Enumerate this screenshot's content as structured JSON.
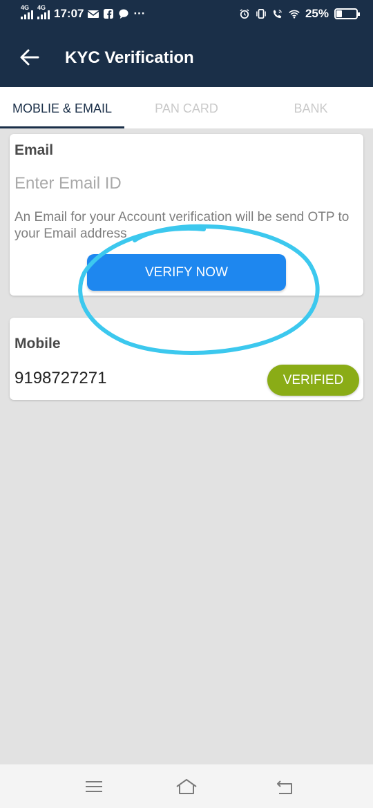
{
  "status_bar": {
    "network_1": "4G",
    "network_2": "4G",
    "time": "17:07",
    "battery_percent": "25%",
    "battery_level": 0.25,
    "icons": [
      "signal-icon",
      "mail-icon",
      "facebook-icon",
      "chat-icon",
      "more-icon",
      "alarm-icon",
      "vibrate-icon",
      "wifi-call-icon",
      "wifi-icon",
      "battery-icon"
    ]
  },
  "app_bar": {
    "title": "KYC Verification",
    "back_icon": "arrow-left-icon"
  },
  "tabs": [
    {
      "label": "MOBLIE & EMAIL",
      "active": true
    },
    {
      "label": "PAN CARD",
      "active": false
    },
    {
      "label": "BANK",
      "active": false
    }
  ],
  "email_card": {
    "title": "Email",
    "input_value": "",
    "input_placeholder": "Enter Email ID",
    "note": "An Email for your Account verification will be send OTP to your Email address",
    "verify_label": "VERIFY NOW"
  },
  "mobile_card": {
    "title": "Mobile",
    "number": "9198727271",
    "status_label": "VERIFIED"
  },
  "nav_bar": {
    "icons": [
      "menu-icon",
      "home-icon",
      "back-icon"
    ]
  },
  "colors": {
    "header": "#1a2f48",
    "primary_button": "#1e87ef",
    "verified": "#8aac16",
    "annotation": "#3cc8ee"
  }
}
